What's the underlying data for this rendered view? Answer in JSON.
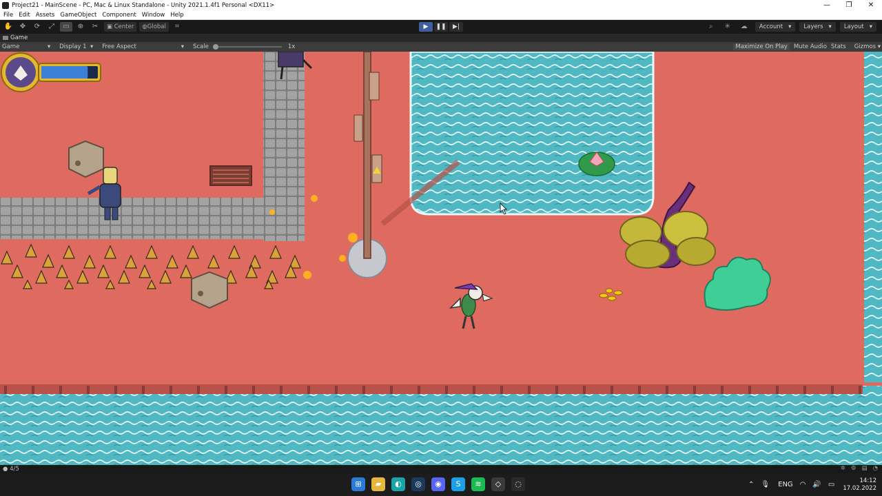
{
  "window": {
    "title": "Project21 - MainScene - PC, Mac & Linux Standalone - Unity 2021.1.4f1 Personal <DX11>",
    "controls": [
      "—",
      "❐",
      "✕"
    ]
  },
  "menu": [
    "File",
    "Edit",
    "Assets",
    "GameObject",
    "Component",
    "Window",
    "Help"
  ],
  "toolbar": {
    "center_label": "Center",
    "global_label": "Global",
    "account_label": "Account",
    "layers_label": "Layers",
    "layout_label": "Layout"
  },
  "game_panel": {
    "tab_label": "Game",
    "mode_label": "Game",
    "display_label": "Display 1",
    "aspect_label": "Free Aspect",
    "scale_label": "Scale",
    "scale_value": "1x",
    "scale_level": 0,
    "maximize_label": "Maximize On Play",
    "mute_label": "Mute Audio",
    "stats_label": "Stats",
    "gizmos_label": "Gizmos"
  },
  "hud": {
    "health_fraction": 0.82
  },
  "status": {
    "console_count": "4/5"
  },
  "taskbar": {
    "lang": "ENG",
    "time": "14:12",
    "date": "17.02.2022"
  },
  "colors": {
    "ground": "#df6a5f",
    "water": "#4fb8c2",
    "stone": "#9a9a9a",
    "play_accent": "#3e5f9b",
    "health_bar": "#3d7fd6"
  }
}
